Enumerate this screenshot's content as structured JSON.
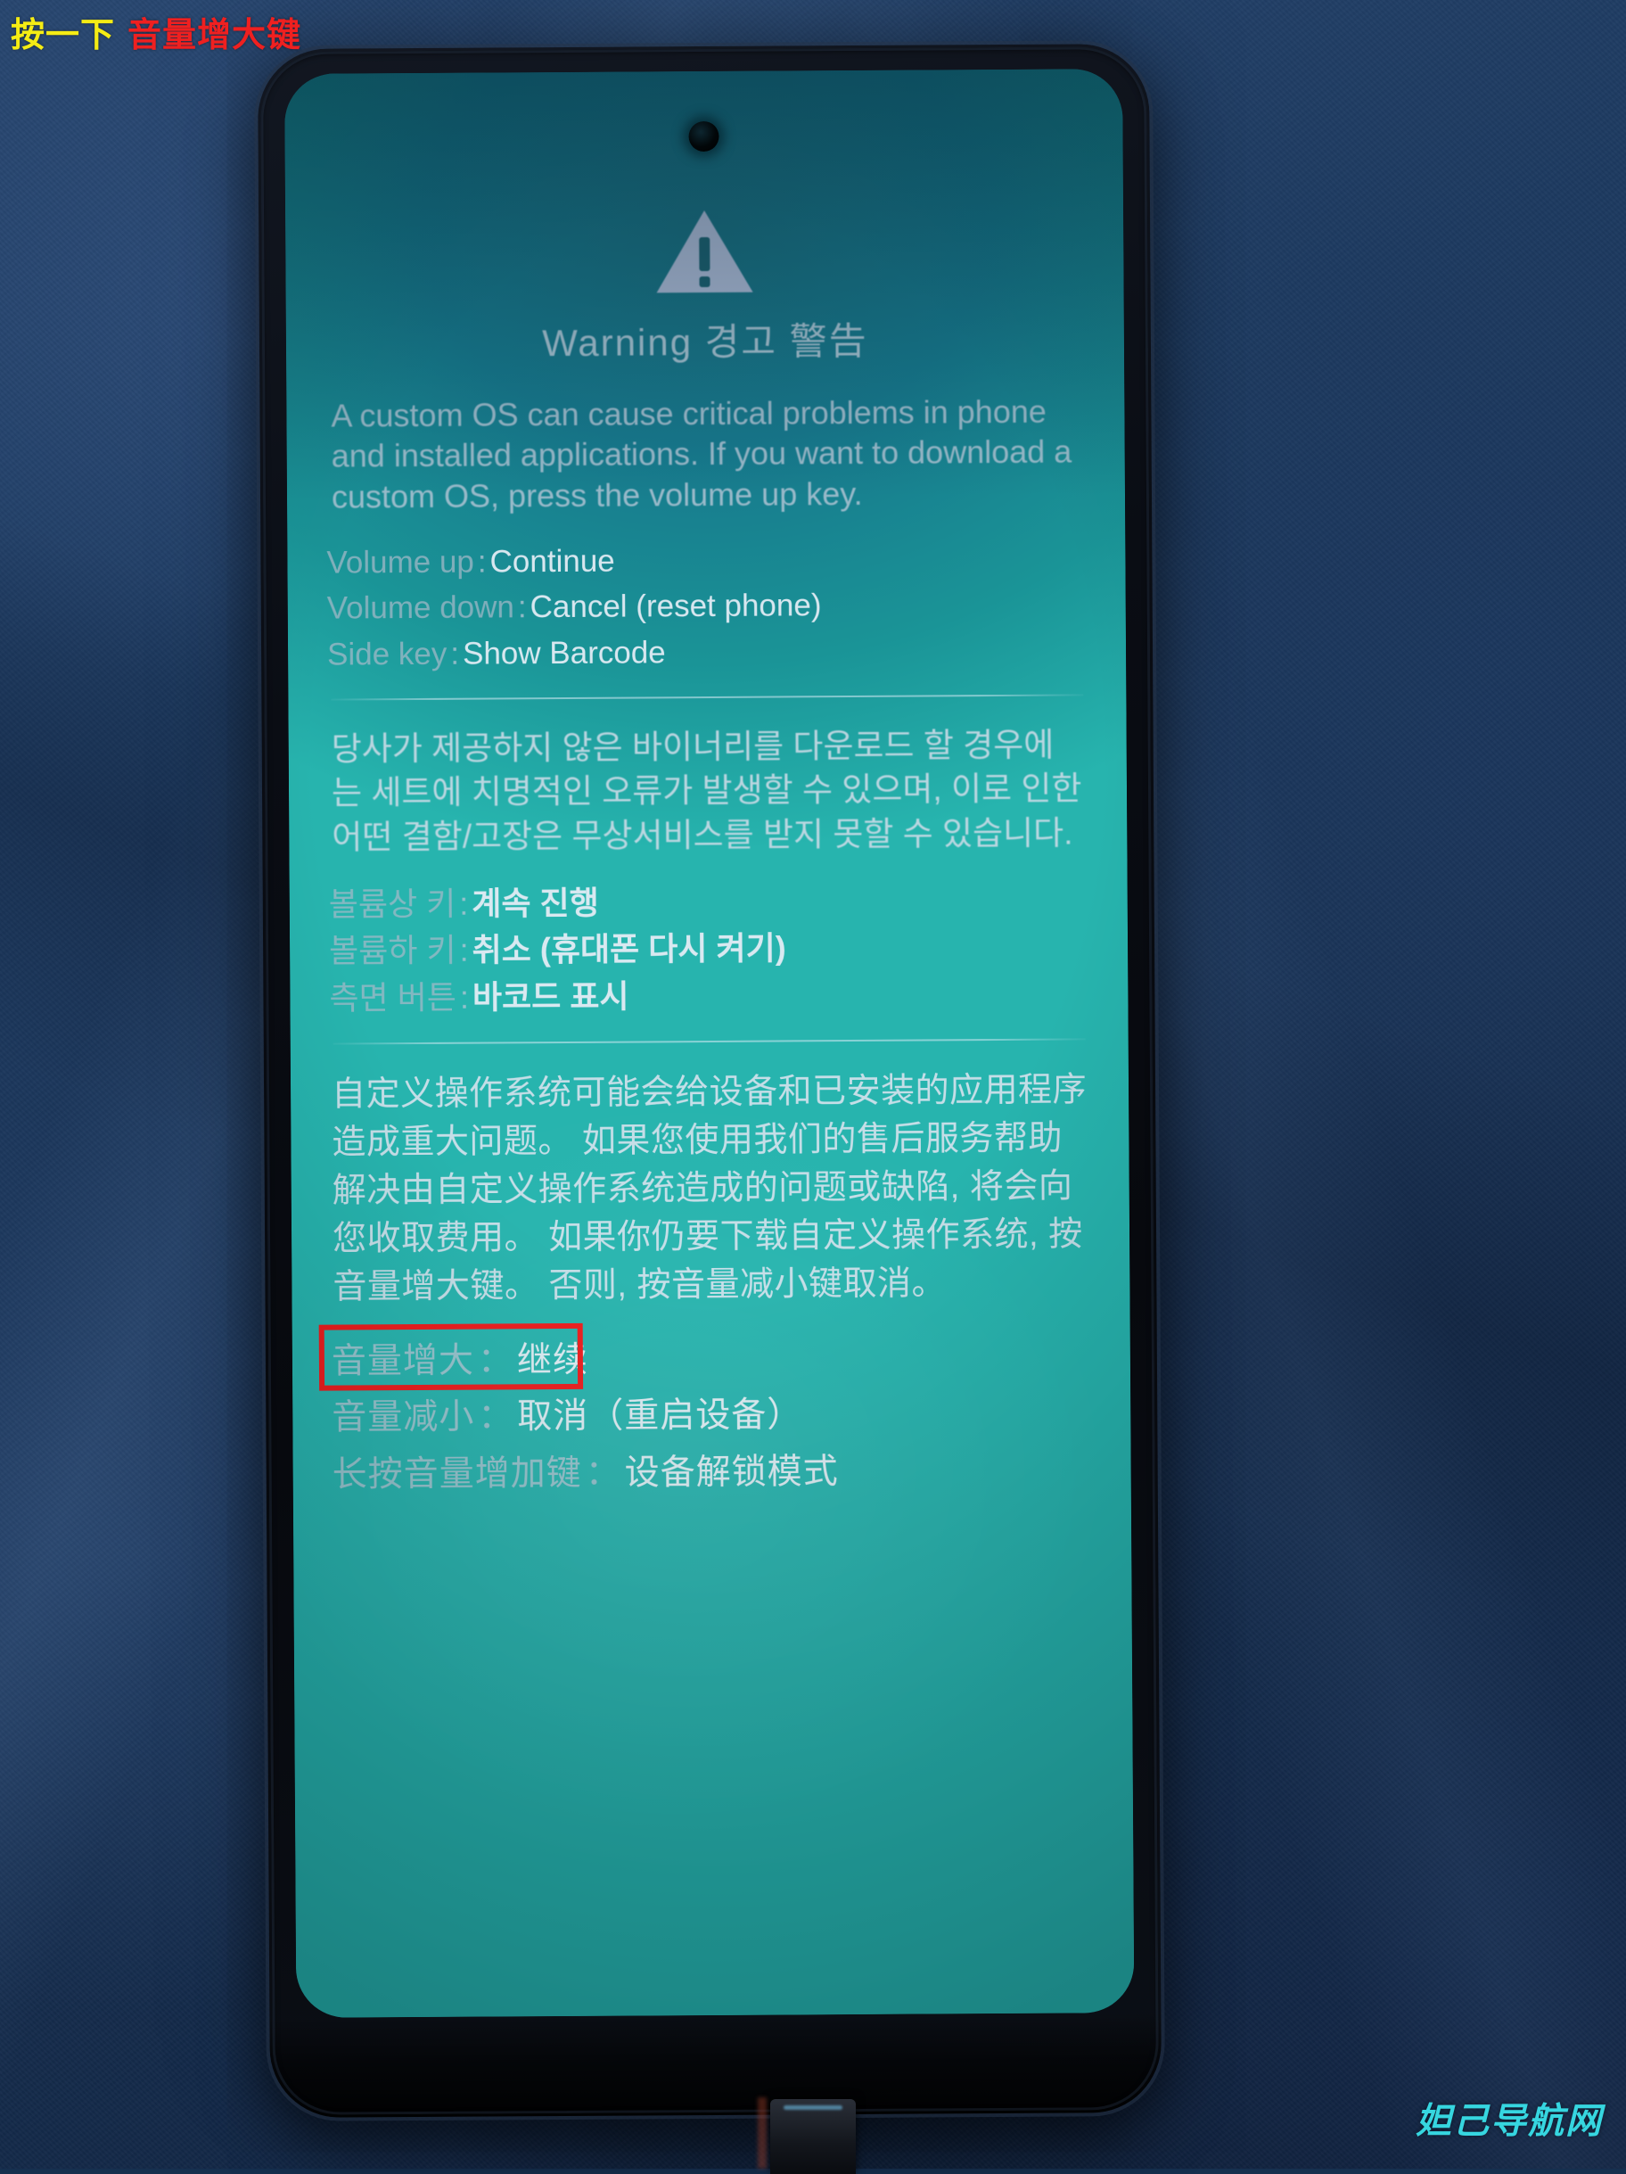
{
  "overlay": {
    "caption_part1": "按一下",
    "caption_part2": "音量增大键",
    "caption_color_1": "#f5ec14",
    "caption_color_2": "#ef2020"
  },
  "watermark": {
    "text": "妲己导航网",
    "color": "#36d6e0"
  },
  "device": {
    "screen_bg_color": "#1a9497",
    "bezel_color": "#0a0d14",
    "background_color": "#1d3a60"
  },
  "screen": {
    "icon": "warning-triangle-icon",
    "title": "Warning 경고 警告",
    "english": {
      "paragraph": "A custom OS can cause critical problems in phone and installed applications. If you want to download a custom OS, press the volume up key.",
      "keys": [
        {
          "label": "Volume up",
          "sep": ":",
          "value": "Continue"
        },
        {
          "label": "Volume down",
          "sep": ":",
          "value": "Cancel (reset phone)"
        },
        {
          "label": "Side key",
          "sep": ":",
          "value": "Show Barcode"
        }
      ]
    },
    "korean": {
      "paragraph": "당사가 제공하지 않은 바이너리를 다운로드 할 경우에는 세트에 치명적인 오류가 발생할 수 있으며, 이로 인한 어떤 결함/고장은 무상서비스를 받지 못할 수 있습니다.",
      "keys": [
        {
          "label": "볼륨상 키",
          "sep": ":",
          "value": "계속 진행"
        },
        {
          "label": "볼륨하 키",
          "sep": ":",
          "value": "취소 (휴대폰 다시 켜기)"
        },
        {
          "label": "측면 버튼",
          "sep": ":",
          "value": "바코드 표시"
        }
      ]
    },
    "chinese": {
      "paragraph": "自定义操作系统可能会给设备和已安装的应用程序造成重大问题。 如果您使用我们的售后服务帮助解决由自定义操作系统造成的问题或缺陷, 将会向您收取费用。 如果你仍要下载自定义操作系统, 按音量增大键。 否则, 按音量减小键取消。",
      "keys": [
        {
          "label": "音量增大",
          "sep": "：",
          "value": "继续",
          "highlighted": true
        },
        {
          "label": "音量减小",
          "sep": "：",
          "value": "取消（重启设备）",
          "highlighted": false
        },
        {
          "label": "长按音量增加键",
          "sep": "：",
          "value": "设备解锁模式",
          "highlighted": false
        }
      ]
    },
    "highlight_color": "#ee1b1b"
  }
}
